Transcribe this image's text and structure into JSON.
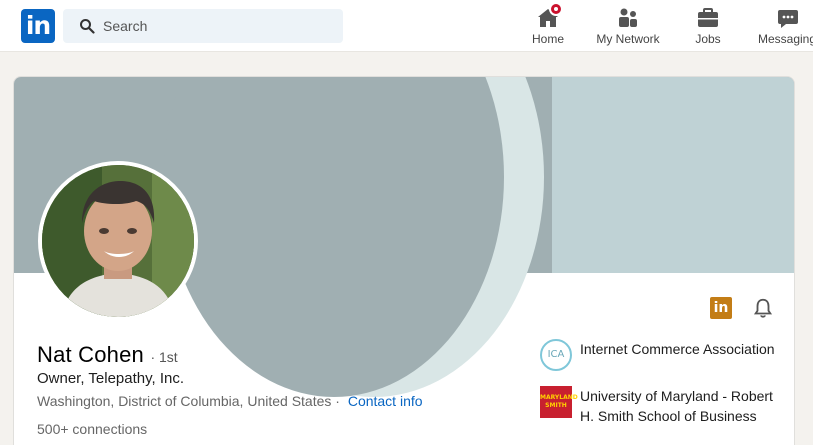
{
  "nav": {
    "search_placeholder": "Search",
    "items": [
      {
        "label": "Home",
        "icon": "home-icon"
      },
      {
        "label": "My Network",
        "icon": "network-icon"
      },
      {
        "label": "Jobs",
        "icon": "briefcase-icon"
      },
      {
        "label": "Messaging",
        "icon": "messaging-icon"
      }
    ]
  },
  "profile": {
    "name": "Nat Cohen",
    "degree": "· 1st",
    "headline": "Owner, Telepathy, Inc.",
    "location": "Washington, District of Columbia, United States ·",
    "contact_info": "Contact info",
    "connections": "500+ connections",
    "organizations": [
      {
        "name": "Internet Commerce Association"
      },
      {
        "name": "University of Maryland - Robert H. Smith School of Business"
      }
    ]
  },
  "colors": {
    "brand": "#0a66c2",
    "badge": "#cb112d",
    "banner": "#a0afb2",
    "premium": "#c37d16"
  }
}
